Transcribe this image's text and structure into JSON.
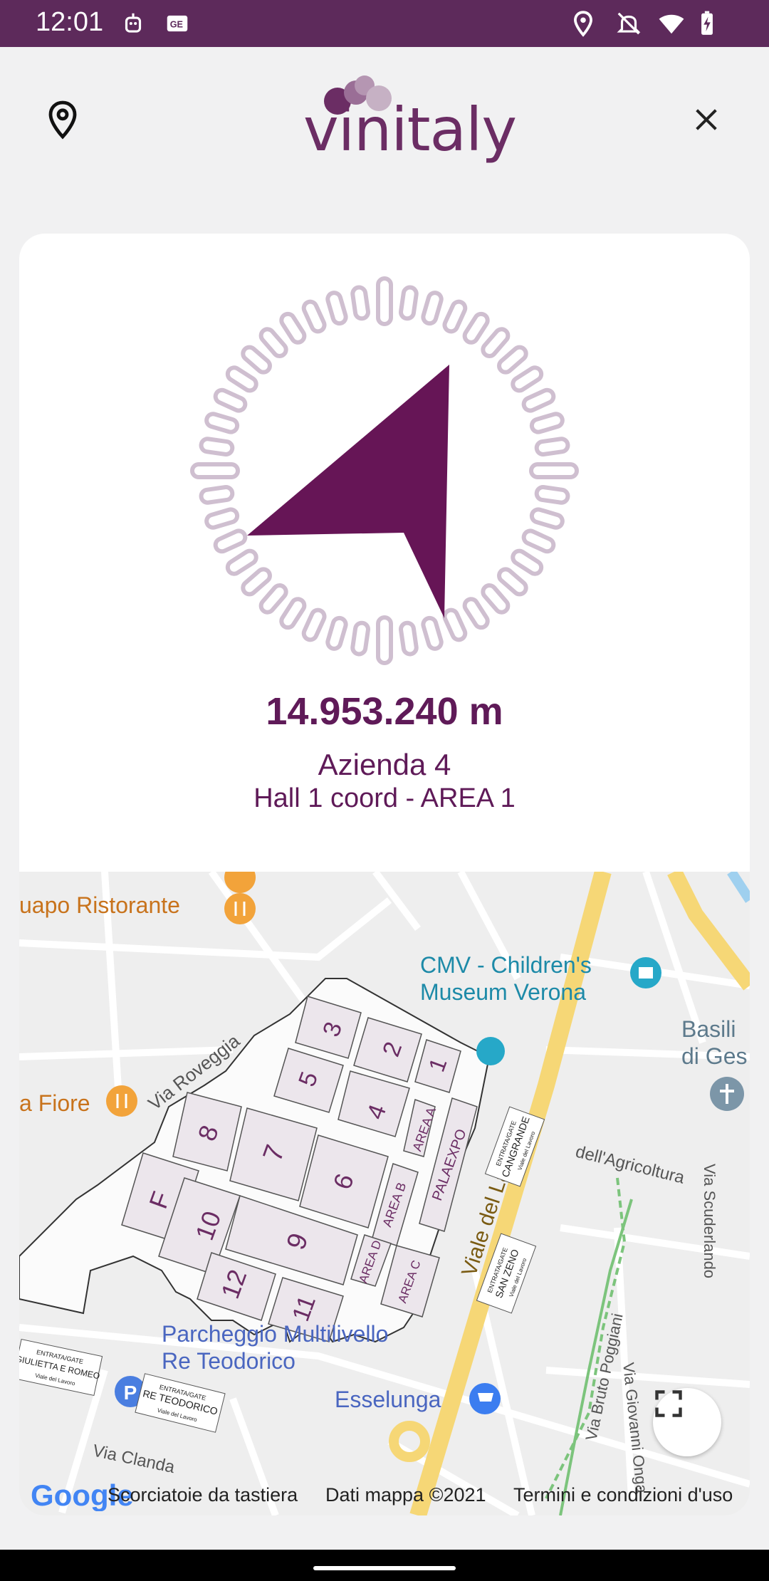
{
  "status_bar": {
    "time": "12:01",
    "icons": [
      "robot-icon",
      "news-icon",
      "location-icon",
      "bell-off-icon",
      "wifi-icon",
      "battery-charging-icon"
    ]
  },
  "header": {
    "logo_text": "vinitaly",
    "left_icon": "location-pin-icon",
    "right_icon": "close-icon"
  },
  "colors": {
    "brand": "#5f1a58",
    "compass_ring": "#cfbfd0",
    "status_bar": "#5d2a5b"
  },
  "navigation": {
    "distance": "14.953.240 m",
    "exhibitor": "Azienda 4",
    "location": "Hall 1 coord - AREA 1"
  },
  "map": {
    "labels": {
      "restaurant": "uapo Ristorante",
      "museum_line1": "CMV - Children's",
      "museum_line2": "Museum Verona",
      "basilica_line1": "Basili",
      "basilica_line2": "di Ges",
      "fiore": "a Fiore",
      "via_roveggia": "Via Roveggia",
      "viale_lavoro": "Viale del Lavoro",
      "agricoltura": "dell'Agricoltura",
      "scuderlando": "Via Scuderlando",
      "parcheggio_line1": "Parcheggio Multilivello",
      "parcheggio_line2": "Re Teodorico",
      "esselunga": "Esselunga",
      "bruto": "Via Bruto Poggiani",
      "onga": "Via Giovanni Onga",
      "clanda": "Via Clanda"
    },
    "halls": [
      "1",
      "2",
      "3",
      "4",
      "5",
      "6",
      "7",
      "8",
      "9",
      "10",
      "11",
      "12",
      "F",
      "AREA A",
      "AREA B",
      "AREA C",
      "AREA D",
      "PALAEXPO"
    ],
    "gates": {
      "cangrande": "CANGRANDE",
      "san_zeno": "SAN ZENO",
      "giulietta": "GIULIETTA E ROMEO",
      "teodorico": "RE TEODORICO",
      "gate_label": "ENTRATA/GATE",
      "street": "Viale del Lavoro"
    },
    "footer": {
      "google": "Google",
      "shortcuts": "Scorciatoie da tastiera",
      "map_data": "Dati mappa ©2021",
      "terms": "Termini e condizioni d'uso"
    },
    "fullscreen_icon": "fullscreen-icon"
  }
}
